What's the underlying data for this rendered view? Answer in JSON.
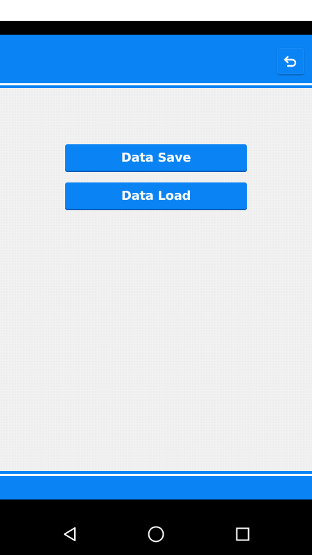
{
  "header": {
    "back_icon": "undo-arrow-icon"
  },
  "menu": {
    "save_label": "Data Save",
    "load_label": "Data Load"
  },
  "nav": {
    "back_icon": "triangle-back-icon",
    "home_icon": "circle-home-icon",
    "recents_icon": "square-recents-icon"
  },
  "colors": {
    "accent": "#0a84f5",
    "content_bg": "#f1f1f1",
    "system_bar": "#000000"
  }
}
